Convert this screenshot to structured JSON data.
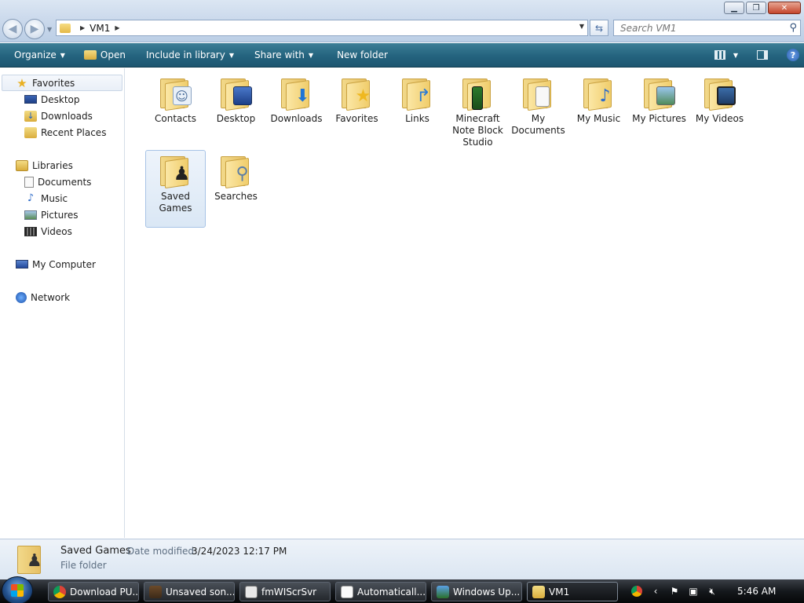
{
  "window": {
    "minimize_icon": "minimize-icon",
    "maximize_icon": "restore-icon",
    "close_icon": "close-icon"
  },
  "address_bar": {
    "crumbs": [
      "VM1"
    ]
  },
  "search": {
    "placeholder": "Search VM1"
  },
  "toolbar": {
    "organize": "Organize",
    "open": "Open",
    "include_in_library": "Include in library",
    "share_with": "Share with",
    "new_folder": "New folder"
  },
  "nav": {
    "favorites": {
      "label": "Favorites",
      "items": [
        "Desktop",
        "Downloads",
        "Recent Places"
      ]
    },
    "libraries": {
      "label": "Libraries",
      "items": [
        "Documents",
        "Music",
        "Pictures",
        "Videos"
      ]
    },
    "my_computer": "My Computer",
    "network": "Network"
  },
  "folders": [
    {
      "name": "Contacts",
      "icon": "contacts-folder-icon"
    },
    {
      "name": "Desktop",
      "icon": "desktop-folder-icon"
    },
    {
      "name": "Downloads",
      "icon": "downloads-folder-icon"
    },
    {
      "name": "Favorites",
      "icon": "favorites-folder-icon"
    },
    {
      "name": "Links",
      "icon": "links-folder-icon"
    },
    {
      "name": "Minecraft Note Block Studio",
      "icon": "minecraft-folder-icon"
    },
    {
      "name": "My Documents",
      "icon": "documents-folder-icon"
    },
    {
      "name": "My Music",
      "icon": "music-folder-icon"
    },
    {
      "name": "My Pictures",
      "icon": "pictures-folder-icon"
    },
    {
      "name": "My Videos",
      "icon": "videos-folder-icon"
    },
    {
      "name": "Saved Games",
      "icon": "saved-games-folder-icon",
      "selected": true
    },
    {
      "name": "Searches",
      "icon": "searches-folder-icon"
    }
  ],
  "details": {
    "name": "Saved Games",
    "modified_label": "Date modified:",
    "modified": "3/24/2023 12:17 PM",
    "type": "File folder"
  },
  "taskbar": {
    "buttons": [
      {
        "label": "Download PU...",
        "icon": "chrome-icon"
      },
      {
        "label": "Unsaved son...",
        "icon": "minecraft-icon"
      },
      {
        "label": "fmWIScrSvr",
        "icon": "app-window-icon"
      },
      {
        "label": "Automaticall...",
        "icon": "document-icon"
      },
      {
        "label": "Windows Up...",
        "icon": "windows-update-icon"
      },
      {
        "label": "VM1",
        "icon": "folder-icon",
        "active": true
      }
    ],
    "clock": "5:46 AM"
  },
  "colors": {
    "command_bar": "#24637e",
    "selection": "#dae7f5"
  }
}
